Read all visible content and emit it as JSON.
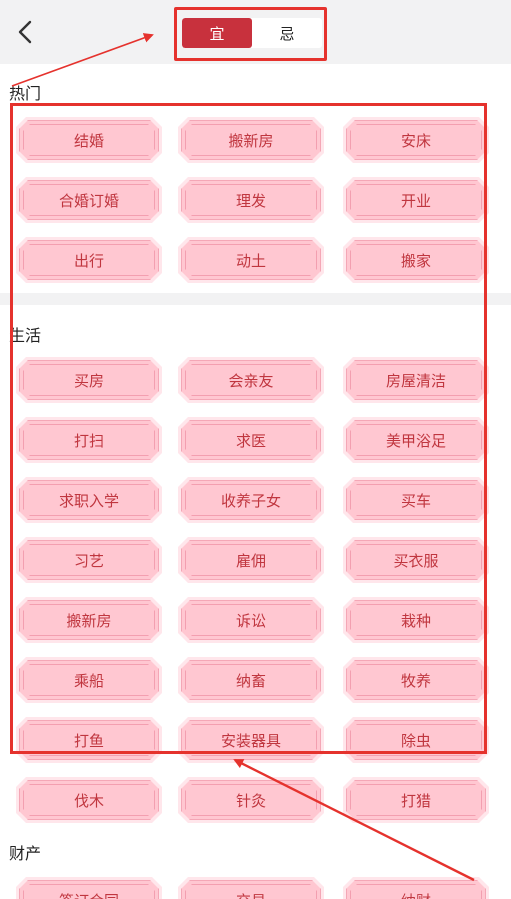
{
  "header": {
    "back_icon": "chevron-left-icon",
    "tabs": [
      {
        "label": "宜",
        "active": true
      },
      {
        "label": "忌",
        "active": false
      }
    ],
    "active_color": "#c8313d"
  },
  "sections": [
    {
      "title": "热门",
      "items": [
        "结婚",
        "搬新房",
        "安床",
        "合婚订婚",
        "理发",
        "开业",
        "出行",
        "动土",
        "搬家"
      ]
    },
    {
      "title": "生活",
      "items": [
        "买房",
        "会亲友",
        "房屋清洁",
        "打扫",
        "求医",
        "美甲浴足",
        "求职入学",
        "收养子女",
        "买车",
        "习艺",
        "雇佣",
        "买衣服",
        "搬新房",
        "诉讼",
        "栽种",
        "乘船",
        "纳畜",
        "牧养",
        "打鱼",
        "安装器具",
        "除虫",
        "伐木",
        "针灸",
        "打猎"
      ]
    },
    {
      "title": "财产",
      "items": [
        "签订合同",
        "交易",
        "纳财"
      ]
    }
  ],
  "colors": {
    "tag_fill": "#ffc7d1",
    "tag_text": "#c0363f",
    "annotation": "#e5322d"
  }
}
